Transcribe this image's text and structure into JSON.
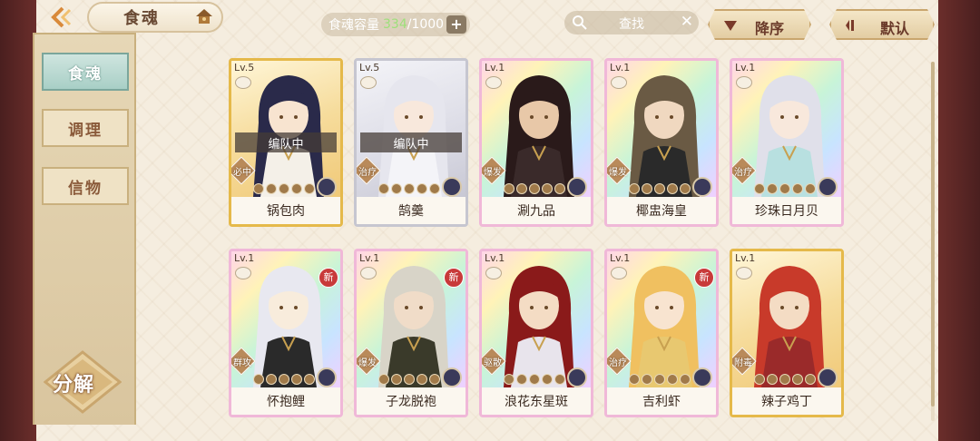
{
  "header": {
    "title": "食魂",
    "capacity_label": "食魂容量",
    "capacity_current": "334",
    "capacity_max": "/1000",
    "search_placeholder": "查找",
    "sort_label": "降序",
    "default_label": "默认"
  },
  "sidebar": {
    "tabs": [
      {
        "label": "食魂",
        "active": true
      },
      {
        "label": "调理",
        "active": false
      },
      {
        "label": "信物",
        "active": false
      }
    ],
    "decompose_label": "分解"
  },
  "cards": [
    {
      "name": "锅包肉",
      "level": "Lv.5",
      "team_label": "编队中",
      "role": "必中",
      "rarity": "gold",
      "new": false
    },
    {
      "name": "鹄羹",
      "level": "Lv.5",
      "team_label": "编队中",
      "role": "治疗",
      "rarity": "silver",
      "new": false
    },
    {
      "name": "涮九品",
      "level": "Lv.1",
      "team_label": "",
      "role": "爆发",
      "rarity": "rainbow",
      "new": false
    },
    {
      "name": "椰盅海皇",
      "level": "Lv.1",
      "team_label": "",
      "role": "爆发",
      "rarity": "rainbow",
      "new": false
    },
    {
      "name": "珍珠日月贝",
      "level": "Lv.1",
      "team_label": "",
      "role": "治疗",
      "rarity": "rainbow",
      "new": false
    },
    {
      "name": "怀抱鲤",
      "level": "Lv.1",
      "team_label": "",
      "role": "群攻",
      "rarity": "rainbow",
      "new": true,
      "new_label": "新"
    },
    {
      "name": "子龙脱袍",
      "level": "Lv.1",
      "team_label": "",
      "role": "爆发",
      "rarity": "rainbow",
      "new": true,
      "new_label": "新"
    },
    {
      "name": "浪花东星斑",
      "level": "Lv.1",
      "team_label": "",
      "role": "驱散",
      "rarity": "rainbow",
      "new": false
    },
    {
      "name": "吉利虾",
      "level": "Lv.1",
      "team_label": "",
      "role": "治疗",
      "rarity": "rainbow",
      "new": true,
      "new_label": "新"
    },
    {
      "name": "辣子鸡丁",
      "level": "Lv.1",
      "team_label": "",
      "role": "附毒",
      "rarity": "gold",
      "new": false
    }
  ],
  "colors": {
    "frame": "#4a1f1f",
    "active_tab": "#a8cfc6",
    "capacity_current": "#9de07a",
    "new_badge": "#c83a3a"
  }
}
